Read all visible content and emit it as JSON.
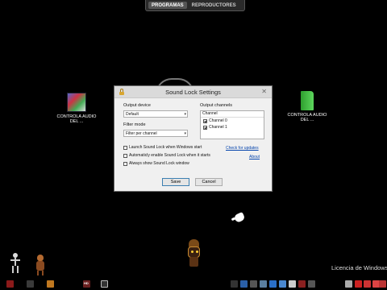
{
  "top_tabs": [
    {
      "label": "PROGRAMAS",
      "active": true
    },
    {
      "label": "REPRODUCTORES",
      "active": false
    }
  ],
  "desktop_icons": [
    {
      "label": "CONTROLA AUDIO DEL ...",
      "icon": "winrar-archive-icon"
    },
    {
      "label": "CONTROLA AUDIO DEL ...",
      "icon": "green-folder-icon"
    }
  ],
  "dialog": {
    "title": "Sound Lock Settings",
    "close_glyph": "✕",
    "output_device": {
      "label": "Output device",
      "value": "Default"
    },
    "filter_mode": {
      "label": "Filter mode",
      "value": "Filter per channel"
    },
    "output_channels": {
      "label": "Output channels",
      "header": "Channel",
      "items": [
        {
          "label": "Channel 0",
          "checked": true
        },
        {
          "label": "Channel 1",
          "checked": true
        }
      ]
    },
    "options": [
      {
        "label": "Launch Sound Lock when Windows start",
        "checked": false
      },
      {
        "label": "Automaticly enable Sound Lock when it starts",
        "checked": false
      },
      {
        "label": "Always show Sound Lock window",
        "checked": false
      }
    ],
    "links": {
      "updates": "Check for updates",
      "about": "About"
    },
    "buttons": {
      "save": "Save",
      "cancel": "Cancel"
    }
  },
  "watermark": "Licencia de Windows",
  "taskbar": {
    "items": [
      {
        "name": "taskbar-icon-1",
        "color": "#8b1a1a",
        "label": ""
      },
      {
        "name": "taskbar-icon-2",
        "color": "#3a3a3a",
        "label": ""
      },
      {
        "name": "taskbar-icon-3",
        "color": "#c07820",
        "label": ""
      },
      {
        "name": "taskbar-icon-4",
        "color": "#6a2020",
        "label": "HD"
      },
      {
        "name": "taskbar-icon-5",
        "color": "#4a4a4a",
        "label": ""
      },
      {
        "name": "taskbar-icon-6",
        "color": "#333333",
        "label": ""
      },
      {
        "name": "taskbar-icon-7",
        "color": "#2a5fa8",
        "label": ""
      },
      {
        "name": "taskbar-icon-8",
        "color": "#555555",
        "label": ""
      },
      {
        "name": "taskbar-icon-9",
        "color": "#5a7fa0",
        "label": ""
      },
      {
        "name": "taskbar-icon-10",
        "color": "#2a6fc8",
        "label": ""
      },
      {
        "name": "taskbar-icon-11",
        "color": "#4a88d0",
        "label": ""
      },
      {
        "name": "taskbar-icon-12",
        "color": "#cccccc",
        "label": ""
      },
      {
        "name": "taskbar-icon-13",
        "color": "#8a2020",
        "label": ""
      },
      {
        "name": "taskbar-icon-14",
        "color": "#555555",
        "label": ""
      },
      {
        "name": "taskbar-icon-15",
        "color": "#aaaaaa",
        "label": ""
      },
      {
        "name": "taskbar-icon-16",
        "color": "#cc2222",
        "label": ""
      },
      {
        "name": "taskbar-icon-17",
        "color": "#cc3333",
        "label": ""
      },
      {
        "name": "taskbar-icon-18",
        "color": "#dd4444",
        "label": ""
      },
      {
        "name": "taskbar-icon-19",
        "color": "#bb3333",
        "label": ""
      }
    ]
  }
}
